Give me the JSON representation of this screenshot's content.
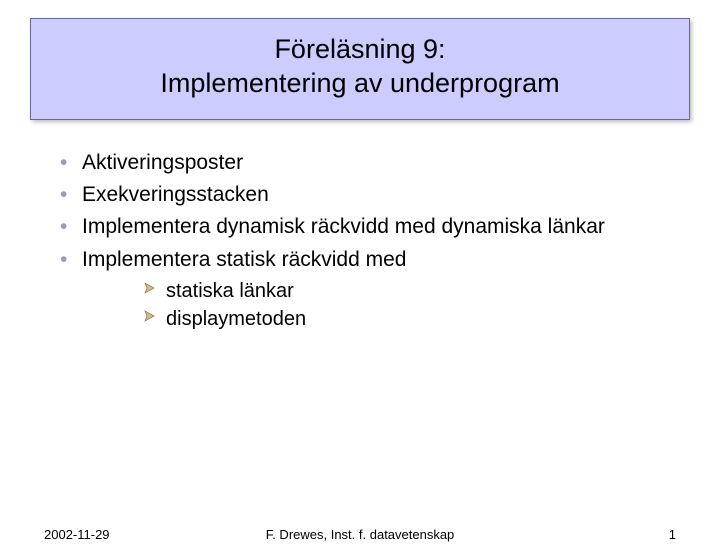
{
  "title": {
    "line1": "Föreläsning 9:",
    "line2": "Implementering av underprogram"
  },
  "bullets": {
    "b1": "Aktiveringsposter",
    "b2": "Exekveringsstacken",
    "b3": "Implementera dynamisk räckvidd med dynamiska länkar",
    "b4": "Implementera statisk räckvidd med",
    "sub1": "statiska länkar",
    "sub2": "displaymetoden"
  },
  "footer": {
    "date": "2002-11-29",
    "author": "F. Drewes, Inst. f. datavetenskap",
    "page": "1"
  },
  "colors": {
    "titleBg": "#ccccff",
    "bulletAccent": "#9999cc",
    "arrowFill": "#d6b98c",
    "arrowStroke": "#8a6d3b"
  }
}
